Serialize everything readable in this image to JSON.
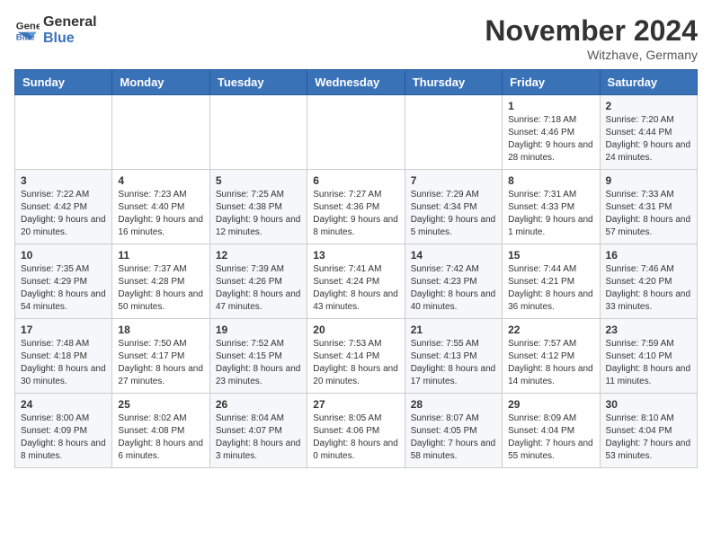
{
  "header": {
    "logo_general": "General",
    "logo_blue": "Blue",
    "month_title": "November 2024",
    "location": "Witzhave, Germany"
  },
  "days_of_week": [
    "Sunday",
    "Monday",
    "Tuesday",
    "Wednesday",
    "Thursday",
    "Friday",
    "Saturday"
  ],
  "weeks": [
    [
      {
        "day": "",
        "info": ""
      },
      {
        "day": "",
        "info": ""
      },
      {
        "day": "",
        "info": ""
      },
      {
        "day": "",
        "info": ""
      },
      {
        "day": "",
        "info": ""
      },
      {
        "day": "1",
        "info": "Sunrise: 7:18 AM\nSunset: 4:46 PM\nDaylight: 9 hours and 28 minutes."
      },
      {
        "day": "2",
        "info": "Sunrise: 7:20 AM\nSunset: 4:44 PM\nDaylight: 9 hours and 24 minutes."
      }
    ],
    [
      {
        "day": "3",
        "info": "Sunrise: 7:22 AM\nSunset: 4:42 PM\nDaylight: 9 hours and 20 minutes."
      },
      {
        "day": "4",
        "info": "Sunrise: 7:23 AM\nSunset: 4:40 PM\nDaylight: 9 hours and 16 minutes."
      },
      {
        "day": "5",
        "info": "Sunrise: 7:25 AM\nSunset: 4:38 PM\nDaylight: 9 hours and 12 minutes."
      },
      {
        "day": "6",
        "info": "Sunrise: 7:27 AM\nSunset: 4:36 PM\nDaylight: 9 hours and 8 minutes."
      },
      {
        "day": "7",
        "info": "Sunrise: 7:29 AM\nSunset: 4:34 PM\nDaylight: 9 hours and 5 minutes."
      },
      {
        "day": "8",
        "info": "Sunrise: 7:31 AM\nSunset: 4:33 PM\nDaylight: 9 hours and 1 minute."
      },
      {
        "day": "9",
        "info": "Sunrise: 7:33 AM\nSunset: 4:31 PM\nDaylight: 8 hours and 57 minutes."
      }
    ],
    [
      {
        "day": "10",
        "info": "Sunrise: 7:35 AM\nSunset: 4:29 PM\nDaylight: 8 hours and 54 minutes."
      },
      {
        "day": "11",
        "info": "Sunrise: 7:37 AM\nSunset: 4:28 PM\nDaylight: 8 hours and 50 minutes."
      },
      {
        "day": "12",
        "info": "Sunrise: 7:39 AM\nSunset: 4:26 PM\nDaylight: 8 hours and 47 minutes."
      },
      {
        "day": "13",
        "info": "Sunrise: 7:41 AM\nSunset: 4:24 PM\nDaylight: 8 hours and 43 minutes."
      },
      {
        "day": "14",
        "info": "Sunrise: 7:42 AM\nSunset: 4:23 PM\nDaylight: 8 hours and 40 minutes."
      },
      {
        "day": "15",
        "info": "Sunrise: 7:44 AM\nSunset: 4:21 PM\nDaylight: 8 hours and 36 minutes."
      },
      {
        "day": "16",
        "info": "Sunrise: 7:46 AM\nSunset: 4:20 PM\nDaylight: 8 hours and 33 minutes."
      }
    ],
    [
      {
        "day": "17",
        "info": "Sunrise: 7:48 AM\nSunset: 4:18 PM\nDaylight: 8 hours and 30 minutes."
      },
      {
        "day": "18",
        "info": "Sunrise: 7:50 AM\nSunset: 4:17 PM\nDaylight: 8 hours and 27 minutes."
      },
      {
        "day": "19",
        "info": "Sunrise: 7:52 AM\nSunset: 4:15 PM\nDaylight: 8 hours and 23 minutes."
      },
      {
        "day": "20",
        "info": "Sunrise: 7:53 AM\nSunset: 4:14 PM\nDaylight: 8 hours and 20 minutes."
      },
      {
        "day": "21",
        "info": "Sunrise: 7:55 AM\nSunset: 4:13 PM\nDaylight: 8 hours and 17 minutes."
      },
      {
        "day": "22",
        "info": "Sunrise: 7:57 AM\nSunset: 4:12 PM\nDaylight: 8 hours and 14 minutes."
      },
      {
        "day": "23",
        "info": "Sunrise: 7:59 AM\nSunset: 4:10 PM\nDaylight: 8 hours and 11 minutes."
      }
    ],
    [
      {
        "day": "24",
        "info": "Sunrise: 8:00 AM\nSunset: 4:09 PM\nDaylight: 8 hours and 8 minutes."
      },
      {
        "day": "25",
        "info": "Sunrise: 8:02 AM\nSunset: 4:08 PM\nDaylight: 8 hours and 6 minutes."
      },
      {
        "day": "26",
        "info": "Sunrise: 8:04 AM\nSunset: 4:07 PM\nDaylight: 8 hours and 3 minutes."
      },
      {
        "day": "27",
        "info": "Sunrise: 8:05 AM\nSunset: 4:06 PM\nDaylight: 8 hours and 0 minutes."
      },
      {
        "day": "28",
        "info": "Sunrise: 8:07 AM\nSunset: 4:05 PM\nDaylight: 7 hours and 58 minutes."
      },
      {
        "day": "29",
        "info": "Sunrise: 8:09 AM\nSunset: 4:04 PM\nDaylight: 7 hours and 55 minutes."
      },
      {
        "day": "30",
        "info": "Sunrise: 8:10 AM\nSunset: 4:04 PM\nDaylight: 7 hours and 53 minutes."
      }
    ]
  ]
}
